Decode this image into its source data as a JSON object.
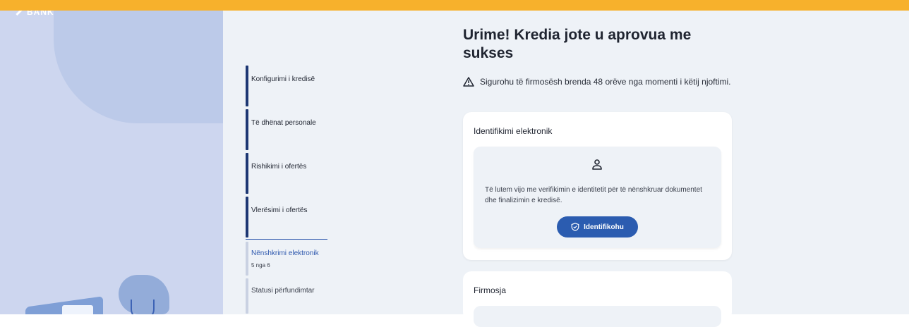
{
  "brand": {
    "logo_text": "BANK"
  },
  "colors": {
    "topbar": "#f7b12c",
    "primary": "#2b5cb0",
    "step_done": "#1d3773"
  },
  "steps": [
    {
      "label": "Konfigurimi i kredisë",
      "state": "done"
    },
    {
      "label": "Të dhënat personale",
      "state": "done"
    },
    {
      "label": "Rishikimi i ofertës",
      "state": "done"
    },
    {
      "label": "Vlerësimi i ofertës",
      "state": "done"
    },
    {
      "label": "Nënshkrimi elektronik",
      "state": "active",
      "sub": "5 nga 6"
    },
    {
      "label": "Statusi përfundimtar",
      "state": "pending"
    }
  ],
  "main": {
    "title": "Urime! Kredia jote u aprovua me sukses",
    "warning": "Sigurohu të firmosësh brenda 48 orëve nga momenti i këtij njoftimi.",
    "identification_card": {
      "title": "Identifikimi elektronik",
      "text": "Të lutem vijo me verifikimin e identitetit për të nënshkruar dokumentet dhe finalizimin e kredisë.",
      "button_label": "Identifikohu"
    },
    "signing_card": {
      "title": "Firmosja"
    }
  },
  "icons": {
    "warning": "warning-icon",
    "user": "user-icon",
    "shield": "shield-check-icon"
  }
}
